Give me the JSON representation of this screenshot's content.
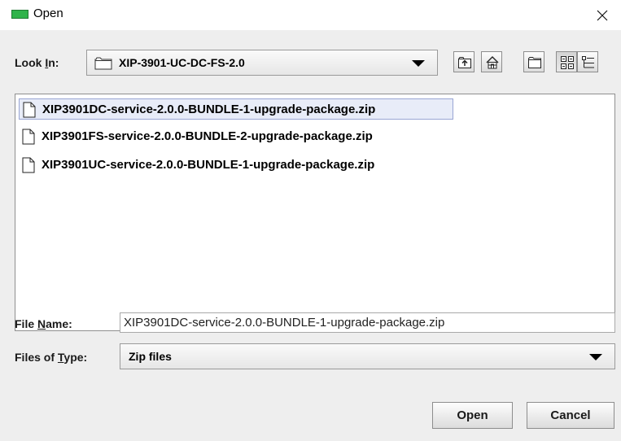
{
  "window": {
    "title": "Open",
    "app_icon": "green-monitor-icon",
    "close_icon": "close-x-icon"
  },
  "look_in": {
    "label_pre": "Look ",
    "label_mnemonic": "I",
    "label_post": "n:",
    "folder_icon": "folder-icon",
    "value": "XIP-3901-UC-DC-FS-2.0"
  },
  "toolbar": {
    "buttons": [
      {
        "name": "up-one-level",
        "icon": "up-folder-icon"
      },
      {
        "name": "home",
        "icon": "home-icon"
      },
      {
        "name": "new-folder",
        "icon": "new-folder-icon"
      },
      {
        "name": "list-view",
        "icon": "list-view-icon",
        "pressed": true
      },
      {
        "name": "details-view",
        "icon": "details-view-icon"
      }
    ]
  },
  "files": {
    "items": [
      {
        "name": "XIP3901DC-service-2.0.0-BUNDLE-1-upgrade-package.zip",
        "selected": true
      },
      {
        "name": "XIP3901FS-service-2.0.0-BUNDLE-2-upgrade-package.zip",
        "selected": false
      },
      {
        "name": "XIP3901UC-service-2.0.0-BUNDLE-1-upgrade-package.zip",
        "selected": false
      }
    ]
  },
  "file_name": {
    "label_pre": "File ",
    "label_mnemonic": "N",
    "label_post": "ame:",
    "value": "XIP3901DC-service-2.0.0-BUNDLE-1-upgrade-package.zip"
  },
  "file_type": {
    "label_pre": "Files of ",
    "label_mnemonic": "T",
    "label_post": "ype:",
    "value": "Zip files"
  },
  "buttons": {
    "open": "Open",
    "cancel": "Cancel"
  },
  "colors": {
    "dialog_bg": "#eeeeee",
    "selection_bg": "#e8ecf8",
    "selection_border": "#9aa6d4",
    "app_icon_green": "#2fb34a"
  }
}
